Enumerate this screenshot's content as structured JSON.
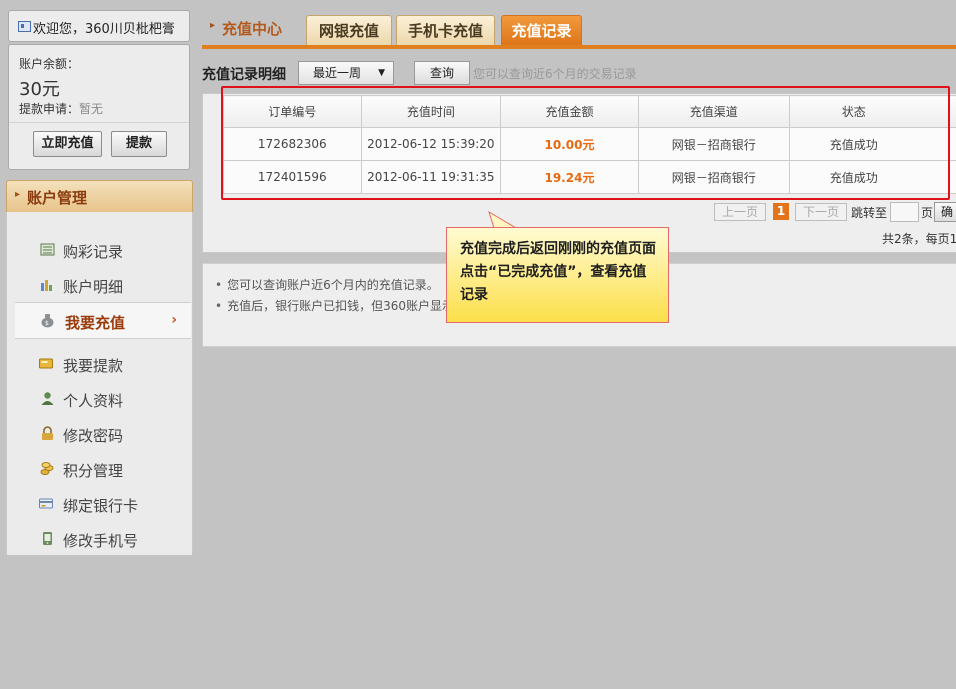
{
  "user": {
    "welcome": "欢迎您，360川贝枇杷膏",
    "balance_label": "账户余额：",
    "balance": "30元",
    "withdraw_label": "提款申请：",
    "withdraw_value": "暂无",
    "recharge_button": "立即充值",
    "withdraw_button": "提款"
  },
  "sidebar": {
    "title": "账户管理",
    "items": [
      {
        "label": "购彩记录",
        "icon": "list-icon"
      },
      {
        "label": "账户明细",
        "icon": "bar-chart-icon"
      },
      {
        "label": "我要充值",
        "icon": "money-bag-icon",
        "active": true
      },
      {
        "label": "我要提款",
        "icon": "wallet-icon"
      },
      {
        "label": "个人资料",
        "icon": "person-icon"
      },
      {
        "label": "修改密码",
        "icon": "lock-icon"
      },
      {
        "label": "积分管理",
        "icon": "coins-icon"
      },
      {
        "label": "绑定银行卡",
        "icon": "bank-card-icon"
      },
      {
        "label": "修改手机号",
        "icon": "phone-icon"
      }
    ]
  },
  "header": {
    "title": "充值中心",
    "tabs": [
      {
        "label": "网银充值",
        "active": false
      },
      {
        "label": "手机卡充值",
        "active": false
      },
      {
        "label": "充值记录",
        "active": true
      }
    ]
  },
  "records": {
    "label": "充值记录明细",
    "period_selected": "最近一周",
    "query_button": "查询",
    "hint": "您可以查询近6个月的交易记录",
    "columns": [
      "订单编号",
      "充值时间",
      "充值金额",
      "充值渠道",
      "状态"
    ],
    "rows": [
      {
        "order_id": "172682306",
        "time": "2012-06-12 15:39:20",
        "amount": "10.00",
        "currency": "元",
        "channel": "网银－招商银行",
        "status": "充值成功"
      },
      {
        "order_id": "172401596",
        "time": "2012-06-11 19:31:35",
        "amount": "19.24",
        "currency": "元",
        "channel": "网银－招商银行",
        "status": "充值成功"
      }
    ]
  },
  "pagination": {
    "prev": "上一页",
    "current": "1",
    "next": "下一页",
    "jump_label": "跳转至",
    "page_unit": "页",
    "confirm": "确",
    "total": "共2条，每页1"
  },
  "notes": [
    "您可以查询账户近6个月内的充值记录。",
    "充值后，银行账户已扣钱，但360账户显示"
  ],
  "callout": {
    "text": "充值完成后返回刚刚的充值页面点击“已完成充值”，查看充值记录"
  },
  "colors": {
    "accent_orange": "#df7f1e",
    "amount_orange": "#e8690f",
    "highlight_red": "#e0111b",
    "callout_yellow": "#fcdf4a"
  }
}
